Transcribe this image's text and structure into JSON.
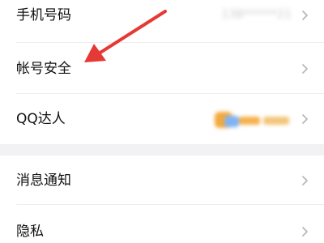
{
  "settings": {
    "phone": {
      "label": "手机号码",
      "value": "138******21"
    },
    "security": {
      "label": "帐号安全"
    },
    "qq_talent": {
      "label": "QQ达人",
      "badge_text": "达人 234天"
    },
    "notifications": {
      "label": "消息通知"
    },
    "privacy": {
      "label": "隐私"
    }
  },
  "colors": {
    "page_background": "#f2f2f5",
    "card_background": "#ffffff",
    "chevron": "#b8b8bc",
    "annotation_arrow": "#e53935"
  }
}
